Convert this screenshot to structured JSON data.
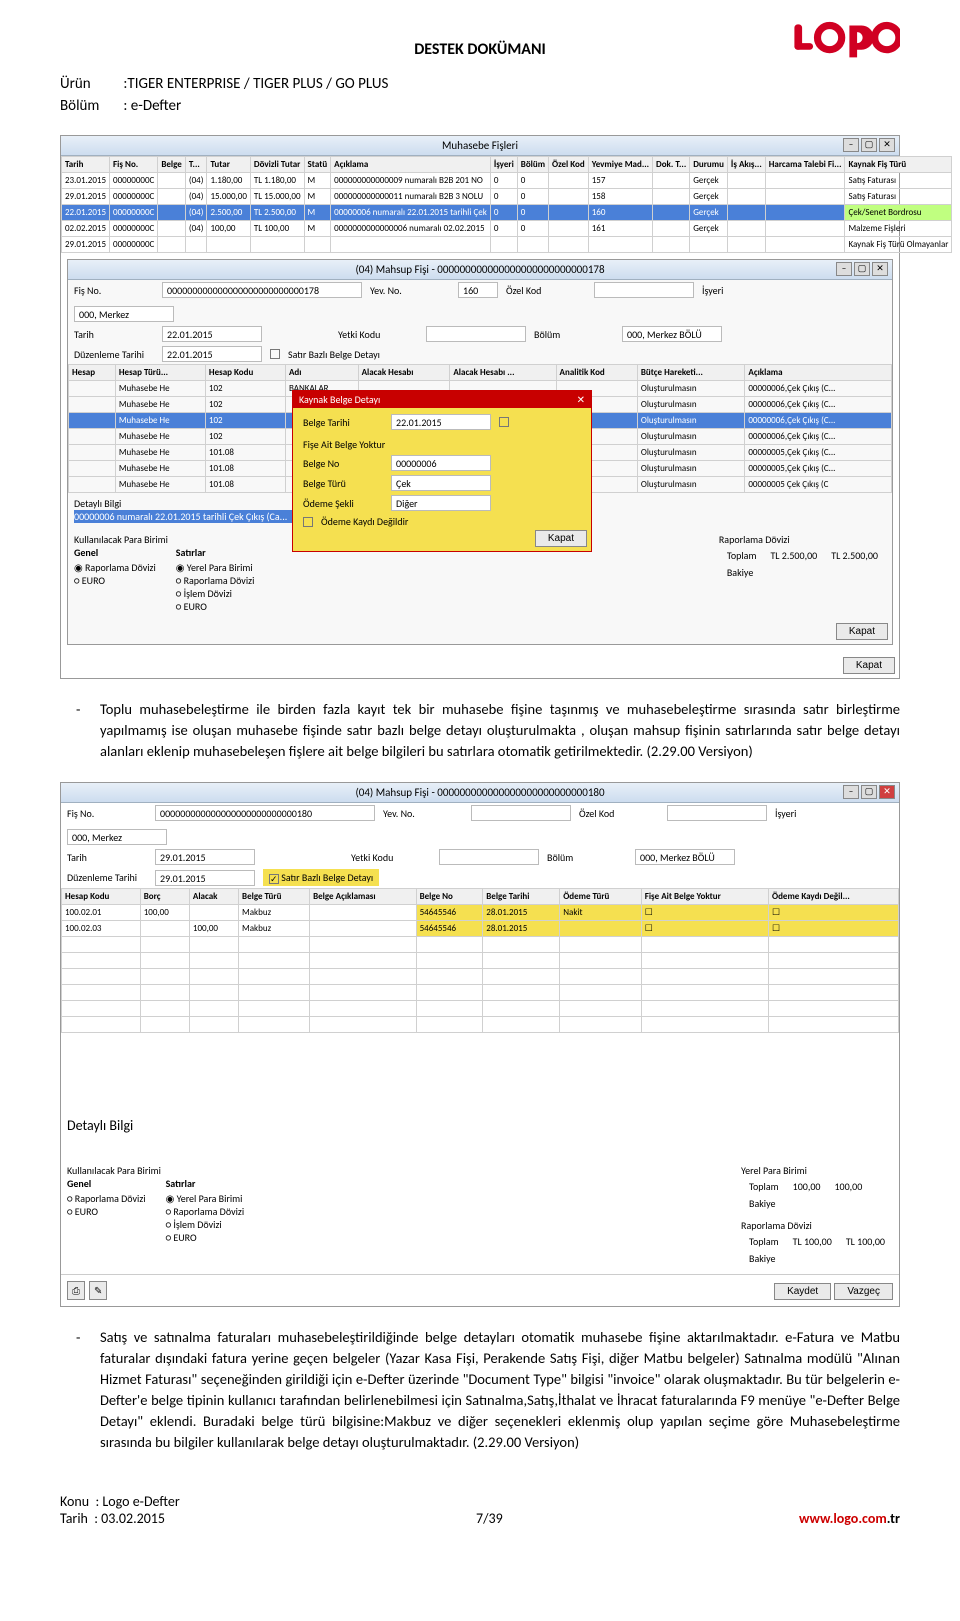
{
  "doc": {
    "title": "DESTEK DOKÜMANI",
    "product_label": "Ürün",
    "product_value": ":TIGER ENTERPRISE / TIGER PLUS / GO PLUS",
    "section_label": "Bölüm",
    "section_value": ": e-Defter",
    "page_ref": "7/39",
    "url": "www.logo.com",
    "url_suffix": ".tr",
    "footer_topic_label": "Konu",
    "footer_topic_value": ": Logo e-Defter",
    "footer_date_label": "Tarih",
    "footer_date_value": ": 03.02.2015"
  },
  "para1": "Toplu muhasebeleştirme ile birden fazla kayıt tek bir muhasebe fişine taşınmış ve muhasebeleştirme sırasında satır birleştirme yapılmamış ise oluşan muhasebe fişinde satır bazlı belge detayı oluşturulmakta , oluşan mahsup fişinin satırlarında satır belge detayı alanları eklenip muhasebeleşen fişlere ait belge bilgileri bu satırlara otomatik getirilmektedir. (2.29.00 Versiyon)",
  "para2": "Satış ve satınalma faturaları muhasebeleştirildiğinde belge detayları otomatik muhasebe fişine aktarılmaktadır. e-Fatura ve Matbu faturalar dışındaki fatura yerine geçen belgeler (Yazar Kasa Fişi, Perakende Satış Fişi, diğer Matbu belgeler) Satınalma modülü \"Alınan Hizmet Faturası\" seçeneğinden girildiği için e-Defter üzerinde \"Document Type\" bilgisi \"invoice\" olarak oluşmaktadır. Bu tür belgelerin e-Defter'e  belge tipinin kullanıcı tarafından belirlenebilmesi için  Satınalma,Satış,İthalat ve İhracat faturalarında F9 menüye \"e-Defter Belge Detayı\" eklendi. Buradaki belge türü bilgisine:Makbuz ve diğer seçenekleri eklenmiş olup yapılan seçime göre Muhasebeleştirme sırasında bu bilgiler kullanılarak belge detayı oluşturulmaktadır. (2.29.00 Versiyon)",
  "shot1": {
    "main_title": "Muhasebe Fişleri",
    "headers": [
      "Tarih",
      "Fiş No.",
      "Belge",
      "T...",
      "Tutar",
      "Dövizli Tutar",
      "Statü",
      "Açıklama",
      "İşyeri",
      "Bölüm",
      "Özel Kod",
      "Yevmiye Mad...",
      "Dok. T...",
      "Durumu",
      "İş Akış...",
      "Harcama Talebi Fi...",
      "Kaynak Fiş Türü"
    ],
    "rows": [
      [
        "23.01.2015",
        "00000000C",
        "",
        "(04)",
        "1.180,00",
        "TL 1.180,00",
        "M",
        "000000000000009 numaralı B2B 201 NO",
        "0",
        "0",
        "",
        "157",
        "",
        "Gerçek",
        "",
        "",
        "Satış Faturası"
      ],
      [
        "29.01.2015",
        "00000000C",
        "",
        "(04)",
        "15.000,00",
        "TL 15.000,00",
        "M",
        "000000000000011 numaralı B2B 3 NOLU",
        "0",
        "0",
        "",
        "158",
        "",
        "Gerçek",
        "",
        "",
        "Satış Faturası"
      ],
      [
        "22.01.2015",
        "00000000C",
        "",
        "(04)",
        "2.500,00",
        "TL 2.500,00",
        "M",
        "00000006 numaralı 22.01.2015 tarihli Çek",
        "0",
        "0",
        "",
        "160",
        "",
        "Gerçek",
        "",
        "",
        "Çek/Senet Bordrosu"
      ],
      [
        "02.02.2015",
        "00000000C",
        "",
        "(04)",
        "100,00",
        "TL 100,00",
        "M",
        "0000000000000006 numaralı 02.02.2015",
        "0",
        "0",
        "",
        "161",
        "",
        "Gerçek",
        "",
        "",
        "Malzeme Fişleri"
      ],
      [
        "29.01.2015",
        "00000000C",
        "",
        "",
        "",
        "",
        "",
        "",
        "",
        "",
        "",
        "",
        "",
        "",
        "",
        "",
        "Kaynak Fiş Türü Olmayanlar"
      ]
    ],
    "sub_title": "(04) Mahsup Fişi - 000000000000000000000000000178",
    "f_fisno_l": "Fiş No.",
    "f_fisno_v": "000000000000000000000000000178",
    "f_tarih_l": "Tarih",
    "f_tarih_v": "22.01.2015",
    "f_duz_l": "Düzenleme Tarihi",
    "f_duz_v": "22.01.2015",
    "f_yev_l": "Yev. No.",
    "f_yev_v": "160",
    "f_ozel_l": "Özel Kod",
    "f_yetki_l": "Yetki Kodu",
    "f_isy_l": "İşyeri",
    "f_isy_v": "000, Merkez",
    "f_bol_l": "Bölüm",
    "f_bol_v": "000, Merkez BÖLÜ",
    "f_sbd": "Satır Bazlı Belge Detayı",
    "sub_headers": [
      "Hesap",
      "Hesap Türü...",
      "Hesap Kodu",
      "Adı",
      "Alacak Hesabı",
      "Alacak Hesabı ...",
      "Analitik Kod",
      "Bütçe Hareketi...",
      "Açıklama"
    ],
    "sub_rows": [
      [
        "",
        "Muhasebe He",
        "102",
        "BANKALAR",
        "",
        "",
        "",
        "Oluşturulmasın",
        "00000006,Çek Çıkış (C..."
      ],
      [
        "",
        "Muhasebe He",
        "102",
        "",
        "",
        "",
        "",
        "Oluşturulmasın",
        "00000006,Çek Çıkış (C..."
      ],
      [
        "",
        "Muhasebe He",
        "102",
        "",
        "",
        "",
        "",
        "Oluşturulmasın",
        "00000006,Çek Çıkış (C..."
      ],
      [
        "",
        "Muhasebe He",
        "102",
        "",
        "",
        "",
        "",
        "Oluşturulmasın",
        "00000006,Çek Çıkış (C..."
      ],
      [
        "",
        "Muhasebe He",
        "101.08",
        "",
        "",
        "",
        "",
        "Oluşturulmasın",
        "00000005,Çek Çıkış (C..."
      ],
      [
        "",
        "Muhasebe He",
        "101.08",
        "",
        "",
        "",
        "",
        "Oluşturulmasın",
        "00000005,Çek Çıkış (C..."
      ],
      [
        "",
        "Muhasebe He",
        "101.08",
        "",
        "",
        "",
        "",
        "Oluşturulmasın",
        "00000005 Çek Çıkış (C"
      ]
    ],
    "ypanel_title": "Kaynak Belge Detayı",
    "yp_bt_l": "Belge Tarihi",
    "yp_bt_v": "22.01.2015",
    "yp_bn_l": "Belge No",
    "yp_bn_v": "00000006",
    "yp_btur_l": "Belge Türü",
    "yp_btur_v": "Çek",
    "yp_os_l": "Ödeme Şekli",
    "yp_os_v": "Diğer",
    "yp_fab": "Fişe Ait Belge Yoktur",
    "yp_okd": "Ödeme Kaydı Değildir",
    "yp_kapat": "Kapat",
    "detayli": "Detaylı Bilgi",
    "detayli_v": "00000006 numaralı 22.01.2015 tarihli Çek Çıkış (Ca...",
    "kpb": "Kullanılacak Para Birimi",
    "genel": "Genel",
    "satirlar": "Satırlar",
    "o_rd": "Raporlama Dövizi",
    "o_euro": "EURO",
    "o_yp": "Yerel Para Birimi",
    "o_rd2": "Raporlama Dövizi",
    "o_id": "İşlem Dövizi",
    "o_euro2": "EURO",
    "rap_doviz": "Raporlama Dövizi",
    "toplam_l": "Toplam",
    "toplam_v1": "TL 2.500,00",
    "toplam_v2": "TL 2.500,00",
    "bakiye_l": "Bakiye",
    "kapat_btn": "Kapat"
  },
  "shot2": {
    "title": "(04) Mahsup Fişi - 000000000000000000000000000180",
    "f_fisno_l": "Fiş No.",
    "f_fisno_v": "000000000000000000000000000180",
    "f_tarih_l": "Tarih",
    "f_tarih_v": "29.01.2015",
    "f_duz_l": "Düzenleme Tarihi",
    "f_duz_v": "29.01.2015",
    "f_yev_l": "Yev. No.",
    "f_ozel_l": "Özel Kod",
    "f_yetki_l": "Yetki Kodu",
    "f_isy_l": "İşyeri",
    "f_isy_v": "000, Merkez",
    "f_bol_l": "Bölüm",
    "f_bol_v": "000, Merkez BÖLÜ",
    "f_sbd": "Satır Bazlı Belge Detayı",
    "headers": [
      "Hesap Kodu",
      "Borç",
      "Alacak",
      "Belge Türü",
      "Belge Açıklaması",
      "Belge No",
      "Belge Tarihi",
      "Ödeme Türü",
      "Fişe Ait Belge Yoktur",
      "Ödeme Kaydı Değil..."
    ],
    "rows": [
      [
        "100.02.01",
        "100,00",
        "",
        "Makbuz",
        "",
        "54645546",
        "28.01.2015",
        "Nakit",
        "☐",
        "☐"
      ],
      [
        "100.02.03",
        "",
        "100,00",
        "Makbuz",
        "",
        "54645546",
        "28.01.2015",
        "",
        "☐",
        "☐"
      ]
    ],
    "detayli": "Detaylı Bilgi",
    "kpb": "Kullanılacak Para Birimi",
    "genel": "Genel",
    "satirlar": "Satırlar",
    "o_rd": "Raporlama Dövizi",
    "o_euro": "EURO",
    "o_yp": "Yerel Para Birimi",
    "o_rd2": "Raporlama Dövizi",
    "o_id": "İşlem Dövizi",
    "o_euro2": "EURO",
    "ypb": "Yerel Para Birimi",
    "toplam_l": "Toplam",
    "toplam_v1": "100,00",
    "toplam_v2": "100,00",
    "bakiye_l": "Bakiye",
    "rap_doviz": "Raporlama Dövizi",
    "rtoplam_v1": "TL 100,00",
    "rtoplam_v2": "TL 100,00",
    "kaydet": "Kaydet",
    "vazgec": "Vazgeç"
  }
}
